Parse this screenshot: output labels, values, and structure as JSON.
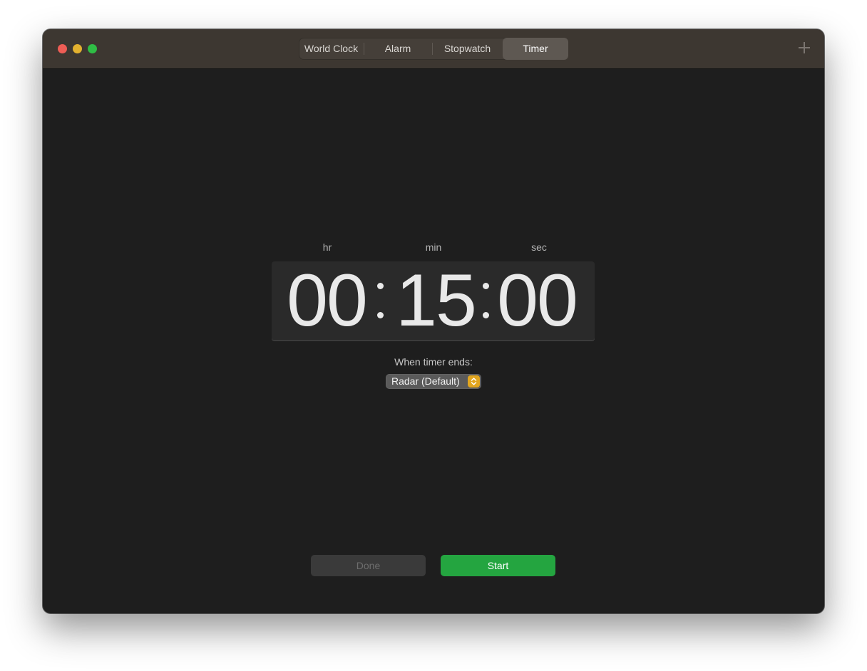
{
  "window": {
    "tabs": [
      {
        "label": "World Clock",
        "active": false
      },
      {
        "label": "Alarm",
        "active": false
      },
      {
        "label": "Stopwatch",
        "active": false
      },
      {
        "label": "Timer",
        "active": true
      }
    ],
    "add_icon": "plus-icon"
  },
  "timer": {
    "units": {
      "hr": "hr",
      "min": "min",
      "sec": "sec"
    },
    "hours": "00",
    "minutes": "15",
    "seconds": "00",
    "when_ends_label": "When timer ends:",
    "sound": "Radar (Default)",
    "sound_icon": "chevron-updown-icon"
  },
  "buttons": {
    "done": "Done",
    "start": "Start"
  },
  "colors": {
    "accent_green": "#24a540",
    "popup_orange": "#e2a61f",
    "close": "#ee5d55",
    "minimize": "#e3b12f",
    "zoom": "#2fbd45"
  }
}
